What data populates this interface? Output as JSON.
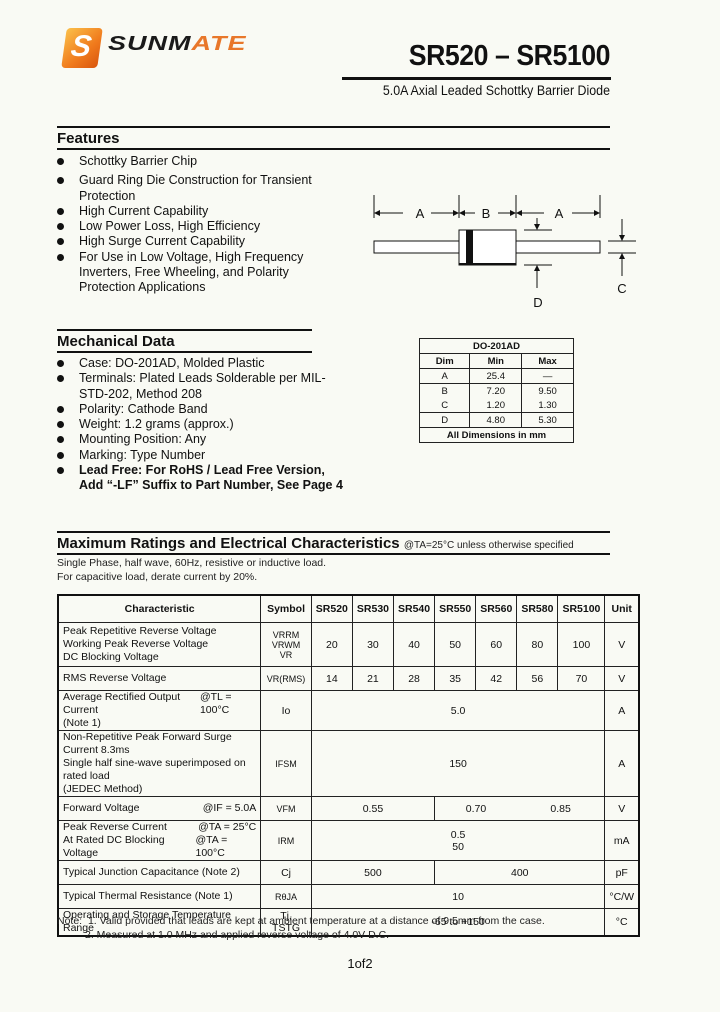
{
  "brand": {
    "logo_mark": "S",
    "name_main": "SUNM",
    "name_accent": "ATE",
    "accent_color": "#e8772a"
  },
  "header": {
    "title": "SR520 – SR5100",
    "subtitle": "5.0A Axial Leaded Schottky Barrier Diode"
  },
  "features": {
    "title": "Features",
    "items": [
      "Schottky Barrier Chip",
      "Guard Ring Die Construction for Transient Protection",
      "High Current Capability",
      "Low Power Loss, High Efficiency",
      "High Surge Current Capability",
      "For Use in Low Voltage, High Frequency Inverters, Free Wheeling, and Polarity Protection Applications"
    ]
  },
  "diagram": {
    "labels": {
      "a_left": "A",
      "b": "B",
      "a_right": "A",
      "c": "C",
      "d": "D"
    }
  },
  "mechanical": {
    "title": "Mechanical Data",
    "items": [
      "Case: DO-201AD, Molded Plastic",
      "Terminals: Plated Leads Solderable per MIL-STD-202, Method 208",
      "Polarity: Cathode Band",
      "Weight: 1.2 grams (approx.)",
      "Mounting Position: Any",
      "Marking: Type Number"
    ],
    "bold_items": [
      "Lead Free: For RoHS / Lead Free Version,",
      "Add “-LF” Suffix to Part Number, See Page 4"
    ]
  },
  "dim_table": {
    "package": "DO-201AD",
    "headers": [
      "Dim",
      "Min",
      "Max"
    ],
    "rows": [
      [
        "A",
        "25.4",
        "—"
      ],
      [
        "B",
        "7.20",
        "9.50"
      ],
      [
        "C",
        "1.20",
        "1.30"
      ],
      [
        "D",
        "4.80",
        "5.30"
      ]
    ],
    "footer": "All Dimensions in mm"
  },
  "ratings": {
    "title": "Maximum Ratings and Electrical Characteristics",
    "condition": "@TA=25°C unless otherwise specified",
    "notes_top": [
      "Single Phase, half wave, 60Hz, resistive or inductive load.",
      "For capacitive load, derate current by 20%."
    ],
    "headers": [
      "Characteristic",
      "Symbol",
      "SR520",
      "SR530",
      "SR540",
      "SR550",
      "SR560",
      "SR580",
      "SR5100",
      "Unit"
    ],
    "rows": {
      "vrrm": {
        "ch": [
          "Peak Repetitive Reverse Voltage",
          "Working Peak Reverse Voltage",
          "DC Blocking Voltage"
        ],
        "sym": [
          "VRRM",
          "VRWM",
          "VR"
        ],
        "vals": [
          "20",
          "30",
          "40",
          "50",
          "60",
          "80",
          "100"
        ],
        "unit": "V"
      },
      "vrms": {
        "ch": "RMS Reverse Voltage",
        "sym": "VR(RMS)",
        "vals": [
          "14",
          "21",
          "28",
          "35",
          "42",
          "56",
          "70"
        ],
        "unit": "V"
      },
      "io": {
        "ch": "Average Rectified Output Current",
        "cond": "@TL = 100°C",
        "ch2": "(Note 1)",
        "sym": "Io",
        "val": "5.0",
        "unit": "A"
      },
      "ifsm": {
        "ch": [
          "Non-Repetitive Peak Forward Surge Current 8.3ms",
          "Single half sine-wave superimposed on rated load",
          "(JEDEC Method)"
        ],
        "sym": "IFSM",
        "val": "150",
        "unit": "A"
      },
      "vfm": {
        "ch": "Forward Voltage",
        "cond": "@IF = 5.0A",
        "sym": "VFM",
        "vals": [
          "0.55",
          "0.70",
          "0.85"
        ],
        "unit": "V"
      },
      "irm": {
        "ch": [
          "Peak Reverse Current",
          "At Rated DC Blocking Voltage"
        ],
        "cond": [
          "@TA = 25°C",
          "@TA = 100°C"
        ],
        "sym": "IRM",
        "vals": [
          "0.5",
          "50"
        ],
        "unit": "mA"
      },
      "cj": {
        "ch": "Typical Junction Capacitance (Note 2)",
        "sym": "Cj",
        "vals": [
          "500",
          "400"
        ],
        "unit": "pF"
      },
      "rja": {
        "ch": "Typical Thermal Resistance (Note 1)",
        "sym": "RθJA",
        "val": "10",
        "unit": "°C/W"
      },
      "tj": {
        "ch": "Operating and Storage Temperature Range",
        "sym": "Tj, TSTG",
        "val": "-65 to +150",
        "unit": "°C"
      }
    }
  },
  "notes": {
    "label": "Note:",
    "items": [
      "1. Valid provided that leads are kept at ambient temperature at a distance of 9.5mm from the case.",
      "2. Measured at 1.0 MHz and applied reverse voltage of 4.0V D.C."
    ]
  },
  "page": "1of2"
}
